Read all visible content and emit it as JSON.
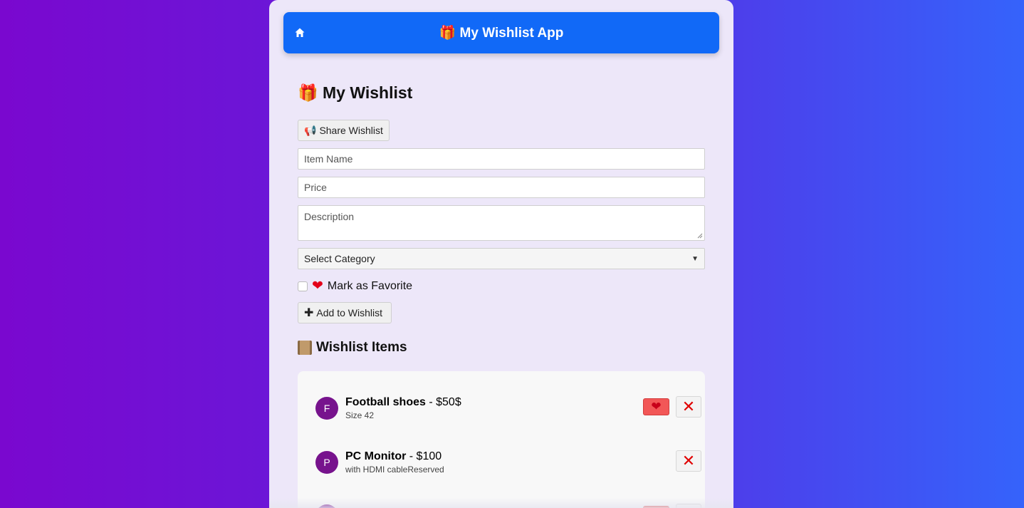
{
  "navbar": {
    "title": "🎁 My Wishlist App",
    "home_icon": "home-icon"
  },
  "heading": "🎁 My Wishlist",
  "share_button": {
    "icon": "📢",
    "label": "Share Wishlist"
  },
  "form": {
    "item_name_placeholder": "Item Name",
    "price_placeholder": "Price",
    "description_placeholder": "Description",
    "category_selected": "Select Category",
    "favorite_label": "Mark as Favorite",
    "add_button_label": "Add to Wishlist"
  },
  "list_heading": "Wishlist Items",
  "items": [
    {
      "initial": "F",
      "name": "Football shoes",
      "price": " - $50$",
      "description": "Size 42",
      "favorite": true
    },
    {
      "initial": "P",
      "name": "PC Monitor",
      "price": " - $100",
      "description": "with HDMI cableReserved",
      "favorite": false
    }
  ],
  "colors": {
    "navbar": "#1169f7",
    "avatar": "#77138d",
    "favorite": "#f25757",
    "delete": "#e00000"
  }
}
